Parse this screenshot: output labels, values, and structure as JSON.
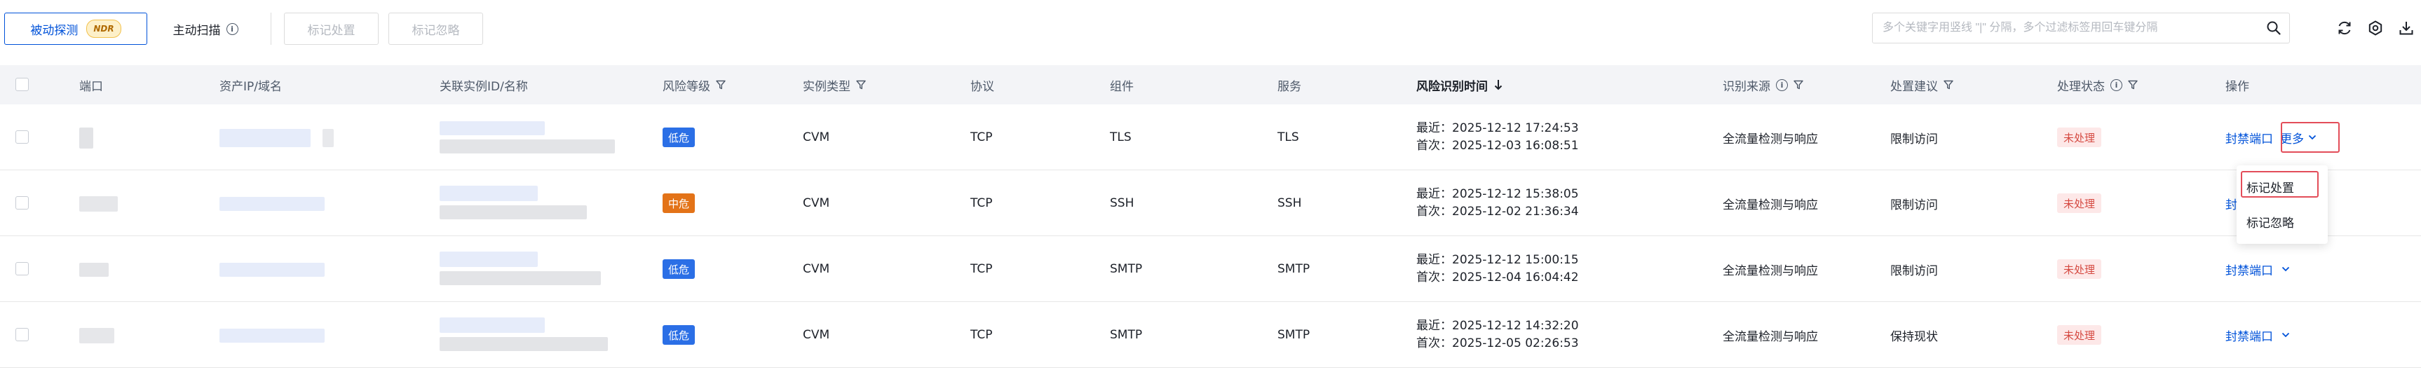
{
  "toolbar": {
    "passive_tab": "被动探测",
    "passive_badge": "NDR",
    "active_tab": "主动扫描",
    "mark_handle_label": "标记处置",
    "mark_ignore_label": "标记忽略",
    "search_placeholder": "多个关键字用竖线 \"|\" 分隔，多个过滤标签用回车键分隔",
    "search_value": ""
  },
  "table": {
    "headers": {
      "port": "端口",
      "asset": "资产IP/域名",
      "instance": "关联实例ID/名称",
      "risk_level": "风险等级",
      "instance_type": "实例类型",
      "protocol": "协议",
      "component": "组件",
      "service": "服务",
      "time": "风险识别时间",
      "source": "识别来源",
      "suggestion": "处置建议",
      "status": "处理状态",
      "action": "操作"
    },
    "rows": [
      {
        "risk_level": "低危",
        "level_color": "#2b6fe6",
        "instance_type": "CVM",
        "protocol": "TCP",
        "component": "TLS",
        "service": "TLS",
        "recent": "最近：2025-12-12 17:24:53",
        "first": "首次：2025-12-03 16:08:51",
        "source": "全流量检测与响应",
        "suggestion": "限制访问",
        "status": "未处理",
        "action_block": "封禁端口",
        "action_more": "更多"
      },
      {
        "risk_level": "中危",
        "level_color": "#e37318",
        "instance_type": "CVM",
        "protocol": "TCP",
        "component": "SSH",
        "service": "SSH",
        "recent": "最近：2025-12-12 15:38:05",
        "first": "首次：2025-12-02 21:36:34",
        "source": "全流量检测与响应",
        "suggestion": "限制访问",
        "status": "未处理",
        "action_block": "封禁",
        "action_more": ""
      },
      {
        "risk_level": "低危",
        "level_color": "#2b6fe6",
        "instance_type": "CVM",
        "protocol": "TCP",
        "component": "SMTP",
        "service": "SMTP",
        "recent": "最近：2025-12-12 15:00:15",
        "first": "首次：2025-12-04 16:04:42",
        "source": "全流量检测与响应",
        "suggestion": "限制访问",
        "status": "未处理",
        "action_block": "封禁端口",
        "action_more": ""
      },
      {
        "risk_level": "低危",
        "level_color": "#2b6fe6",
        "instance_type": "CVM",
        "protocol": "TCP",
        "component": "SMTP",
        "service": "SMTP",
        "recent": "最近：2025-12-12 14:32:20",
        "first": "首次：2025-12-05 02:26:53",
        "source": "全流量检测与响应",
        "suggestion": "保持现状",
        "status": "未处理",
        "action_block": "封禁端口",
        "action_more": ""
      }
    ]
  },
  "dropdown": {
    "items": [
      "标记处置",
      "标记忽略"
    ]
  },
  "colors": {
    "primary": "#0052d9",
    "danger": "#d54941",
    "highlight": "#e34d59"
  }
}
